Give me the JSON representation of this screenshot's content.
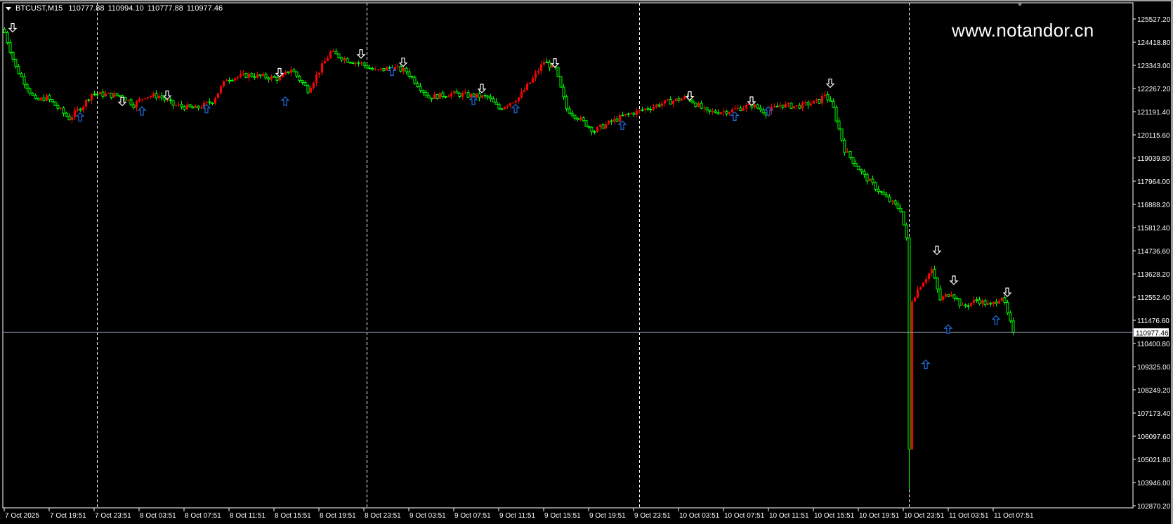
{
  "header": {
    "symbol": "BTCUST,M15",
    "open": "110777.88",
    "high": "110994.10",
    "low": "110777.88",
    "close": "110977.46"
  },
  "watermark": "www.notandor.cn",
  "colors": {
    "bull": "#ff0000",
    "bear": "#00ff00",
    "grid": "#ffffff",
    "bid_line": "#7f8c9a",
    "up_arrow": "#1e6fe0",
    "down_arrow": "#ffffff"
  },
  "chart_data": {
    "type": "candlestick",
    "title": "BTCUST,M15",
    "ylim": [
      102870.2,
      125527.2
    ],
    "y_ticks": [
      "125527.20",
      "124418.80",
      "123343.00",
      "122267.20",
      "121191.40",
      "120115.60",
      "119039.80",
      "117964.00",
      "116888.20",
      "115812.40",
      "114736.60",
      "113628.20",
      "112552.40",
      "111476.60",
      "110400.80",
      "109325.00",
      "108249.20",
      "107173.40",
      "106097.60",
      "105021.80",
      "103946.00",
      "102870.20"
    ],
    "current_price": "110977.46",
    "x_ticks": [
      "7 Oct 2025",
      "7 Oct 19:51",
      "7 Oct 23:51",
      "8 Oct 03:51",
      "8 Oct 07:51",
      "8 Oct 11:51",
      "8 Oct 15:51",
      "8 Oct 19:51",
      "8 Oct 23:51",
      "9 Oct 03:51",
      "9 Oct 07:51",
      "9 Oct 11:51",
      "9 Oct 15:51",
      "9 Oct 19:51",
      "9 Oct 23:51",
      "10 Oct 03:51",
      "10 Oct 07:51",
      "10 Oct 11:51",
      "10 Oct 15:51",
      "10 Oct 19:51",
      "10 Oct 23:51",
      "11 Oct 03:51",
      "11 Oct 07:51"
    ],
    "bars_per_tick": 16,
    "period_separators_bar": [
      33,
      129,
      226,
      322
    ],
    "price_path": [
      [
        0,
        124900
      ],
      [
        4,
        123277
      ],
      [
        11,
        121712
      ],
      [
        15,
        121886
      ],
      [
        23,
        120912
      ],
      [
        28,
        121538
      ],
      [
        31,
        122060
      ],
      [
        42,
        121956
      ],
      [
        46,
        121538
      ],
      [
        50,
        121956
      ],
      [
        55,
        121956
      ],
      [
        60,
        121538
      ],
      [
        68,
        121364
      ],
      [
        74,
        121712
      ],
      [
        79,
        122756
      ],
      [
        87,
        122929
      ],
      [
        98,
        122756
      ],
      [
        102,
        123208
      ],
      [
        108,
        122234
      ],
      [
        114,
        123556
      ],
      [
        116,
        123973
      ],
      [
        122,
        123625
      ],
      [
        127,
        123451
      ],
      [
        132,
        123103
      ],
      [
        138,
        123277
      ],
      [
        143,
        123103
      ],
      [
        151,
        121886
      ],
      [
        159,
        122060
      ],
      [
        167,
        121956
      ],
      [
        172,
        121886
      ],
      [
        176,
        121364
      ],
      [
        183,
        121886
      ],
      [
        188,
        122756
      ],
      [
        192,
        123556
      ],
      [
        196,
        123208
      ],
      [
        200,
        121364
      ],
      [
        210,
        120321
      ],
      [
        212,
        120495
      ],
      [
        220,
        121016
      ],
      [
        226,
        121260
      ],
      [
        234,
        121608
      ],
      [
        243,
        121886
      ],
      [
        250,
        121190
      ],
      [
        258,
        121260
      ],
      [
        266,
        121538
      ],
      [
        271,
        121190
      ],
      [
        276,
        121538
      ],
      [
        282,
        121468
      ],
      [
        290,
        121712
      ],
      [
        292,
        122060
      ],
      [
        295,
        121364
      ],
      [
        299,
        119451
      ],
      [
        306,
        118234
      ],
      [
        314,
        117191
      ],
      [
        319,
        116669
      ],
      [
        321,
        115278
      ],
      [
        322,
        105539
      ],
      [
        323,
        112495
      ],
      [
        326,
        113191
      ],
      [
        330,
        113886
      ],
      [
        333,
        112495
      ],
      [
        337,
        112843
      ],
      [
        341,
        112147
      ],
      [
        346,
        112495
      ],
      [
        351,
        112217
      ],
      [
        355,
        112669
      ],
      [
        359,
        110977
      ]
    ],
    "spike_low": {
      "bar": 322,
      "price": 103700
    },
    "signals_down": [
      [
        3,
        125120
      ],
      [
        42,
        121700
      ],
      [
        58,
        121990
      ],
      [
        98,
        123034
      ],
      [
        127,
        123903
      ],
      [
        142,
        123520
      ],
      [
        170,
        122303
      ],
      [
        196,
        123486
      ],
      [
        244,
        121955
      ],
      [
        266,
        121712
      ],
      [
        294,
        122547
      ],
      [
        332,
        114790
      ],
      [
        338,
        113400
      ],
      [
        357,
        112843
      ]
    ],
    "signals_up": [
      [
        27,
        120982
      ],
      [
        49,
        121260
      ],
      [
        72,
        121364
      ],
      [
        100,
        121712
      ],
      [
        138,
        123103
      ],
      [
        167,
        121747
      ],
      [
        182,
        121364
      ],
      [
        220,
        120599
      ],
      [
        260,
        121016
      ],
      [
        272,
        121260
      ],
      [
        328,
        109504
      ],
      [
        336,
        111138
      ],
      [
        353,
        111556
      ]
    ]
  }
}
